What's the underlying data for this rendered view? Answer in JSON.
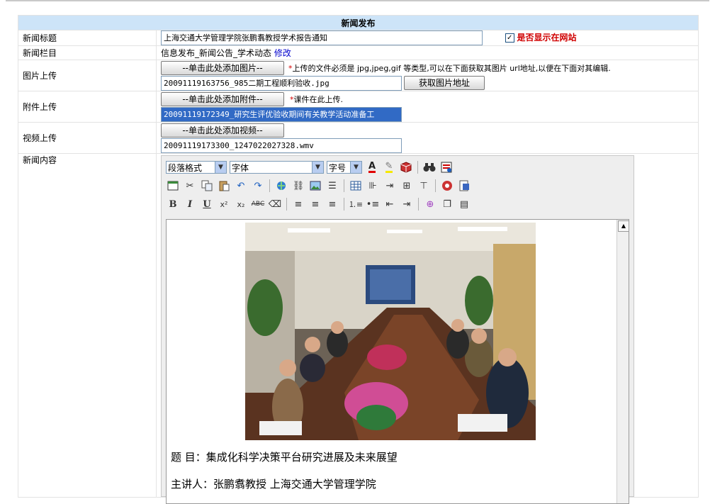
{
  "header": {
    "title": "新闻发布"
  },
  "title_row": {
    "label": "新闻标题",
    "value": "上海交通大学管理学院张鹏翥教授学术报告通知",
    "show_on_site_checked": "✓",
    "show_on_site_label": "是否显示在网站"
  },
  "column_row": {
    "label": "新闻栏目",
    "value": "信息发布_新闻公告_学术动态",
    "edit_link": "修改"
  },
  "image_row": {
    "label": "图片上传",
    "add_button": "--单击此处添加图片--",
    "star": "*",
    "hint": "上传的文件必须是 jpg,jpeg,gif 等类型,可以在下面获取其图片 url地址,以便在下面对其编辑.",
    "file_value": "20091119163756_985二期工程顺利验收.jpg",
    "get_url_button": "获取图片地址"
  },
  "attachment_row": {
    "label": "附件上传",
    "add_button": "--单击此处添加附件--",
    "star": "*",
    "hint": "课件在此上传.",
    "file_value": "20091119172349_研究生评优验收期间有关教学活动准备工"
  },
  "video_row": {
    "label": "视频上传",
    "add_button": "--单击此处添加视频--",
    "file_value": "20091119173300_1247022027328.wmv"
  },
  "content_row": {
    "label": "新闻内容",
    "toolbar": {
      "paragraph_format": "段落格式",
      "font": "字体",
      "font_size": "字号"
    },
    "doc_lines": [
      "题  目：集成化科学决策平台研究进展及未来展望",
      "主讲人：张鹏翥教授  上海交通大学管理学院"
    ]
  },
  "colors": {
    "header_bg": "#cde4f8",
    "accent_red": "#d00000",
    "link_blue": "#0000cc",
    "selection_blue": "#316ac5"
  }
}
